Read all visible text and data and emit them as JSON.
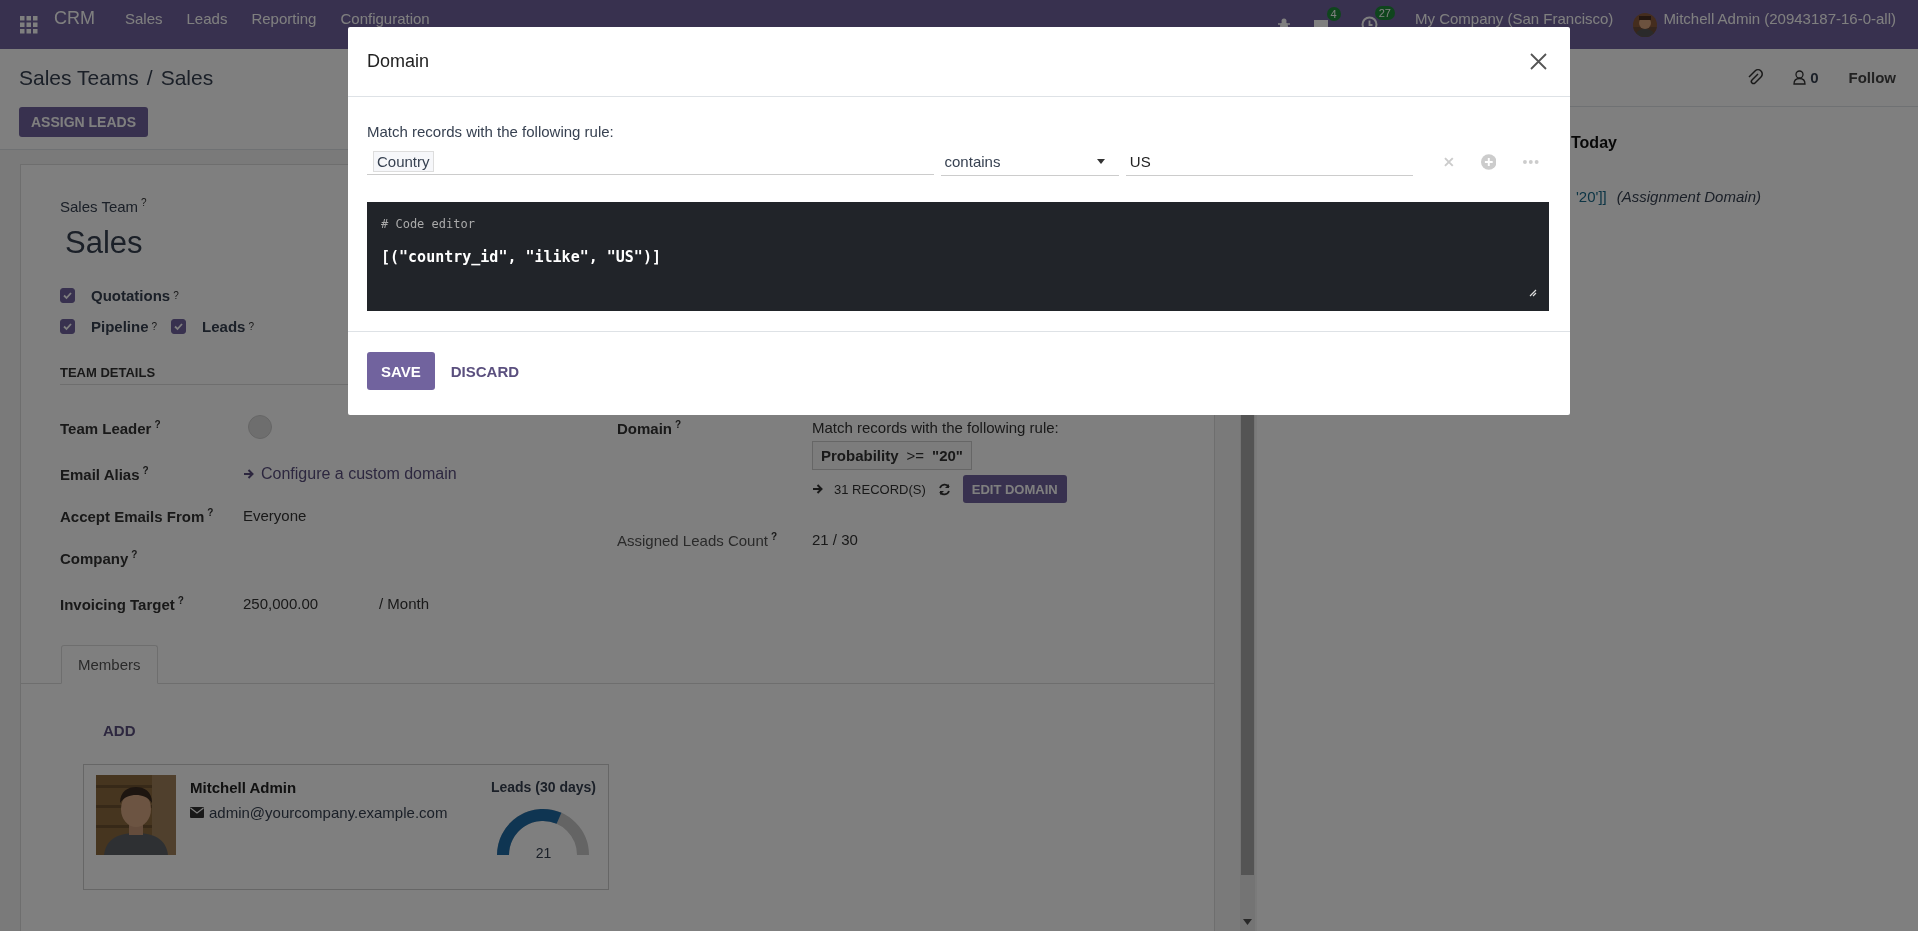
{
  "navbar": {
    "app_name": "CRM",
    "menu": [
      "Sales",
      "Leads",
      "Reporting",
      "Configuration"
    ],
    "messages_count": "4",
    "activities_count": "27",
    "company": "My Company (San Francisco)",
    "user": "Mitchell Admin (20943187-16-0-all)"
  },
  "breadcrumb": {
    "items": [
      "Sales Teams",
      "Sales"
    ],
    "separator": "/"
  },
  "actions": [
    "ASSIGN LEADS"
  ],
  "chatter": {
    "followers_count": "0",
    "follow": "Follow",
    "date_heading": "Today",
    "message_value": "'20']]",
    "message_note": "(Assignment Domain)"
  },
  "form": {
    "title_label": "Sales Team",
    "title_help": "?",
    "name": "Sales",
    "option_rows": [
      [
        {
          "label": "Quotations",
          "help": "?",
          "checked": true
        }
      ],
      [
        {
          "label": "Pipeline",
          "help": "?",
          "checked": true
        },
        {
          "label": "Leads",
          "help": "?",
          "checked": true
        }
      ]
    ],
    "section": "TEAM DETAILS",
    "left_fields": [
      {
        "label": "Team Leader",
        "help": "?",
        "kind": "avatar"
      },
      {
        "label": "Email Alias",
        "help": "?",
        "kind": "link",
        "value": "Configure a custom domain"
      },
      {
        "label": "Accept Emails From",
        "help": "?",
        "kind": "text",
        "value": "Everyone"
      },
      {
        "label": "Company",
        "help": "?",
        "kind": "empty"
      },
      {
        "label": "Invoicing Target",
        "help": "?",
        "kind": "amount",
        "value": "250,000.00",
        "unit": "/ Month"
      }
    ],
    "domain": {
      "label": "Domain",
      "help": "?",
      "rule_intro": "Match records with the following rule:",
      "rule_field": "Probability",
      "rule_operator": ">=",
      "rule_value": "\"20\"",
      "records": "31 RECORD(S)",
      "edit_button": "EDIT DOMAIN"
    },
    "assigned": {
      "label": "Assigned Leads Count",
      "help": "?",
      "value": "21 / 30"
    }
  },
  "tabs": [
    {
      "label": "Members",
      "selected": true
    }
  ],
  "members": {
    "add": "ADD",
    "cards": [
      {
        "name": "Mitchell Admin",
        "email": "admin@yourcompany.example.com",
        "gauge_title": "Leads (30 days)",
        "gauge_value": "21",
        "level": 0.7
      }
    ]
  },
  "dialog": {
    "title": "Domain",
    "intro": "Match records with the following rule:",
    "path": "Country",
    "operator": "contains",
    "value": "US",
    "editor_comment": "# Code editor",
    "code": "[(\"country_id\", \"ilike\", \"US\")]",
    "buttons": [
      {
        "label": "SAVE",
        "kind": "primary"
      },
      {
        "label": "DISCARD",
        "kind": "secondary"
      }
    ]
  }
}
